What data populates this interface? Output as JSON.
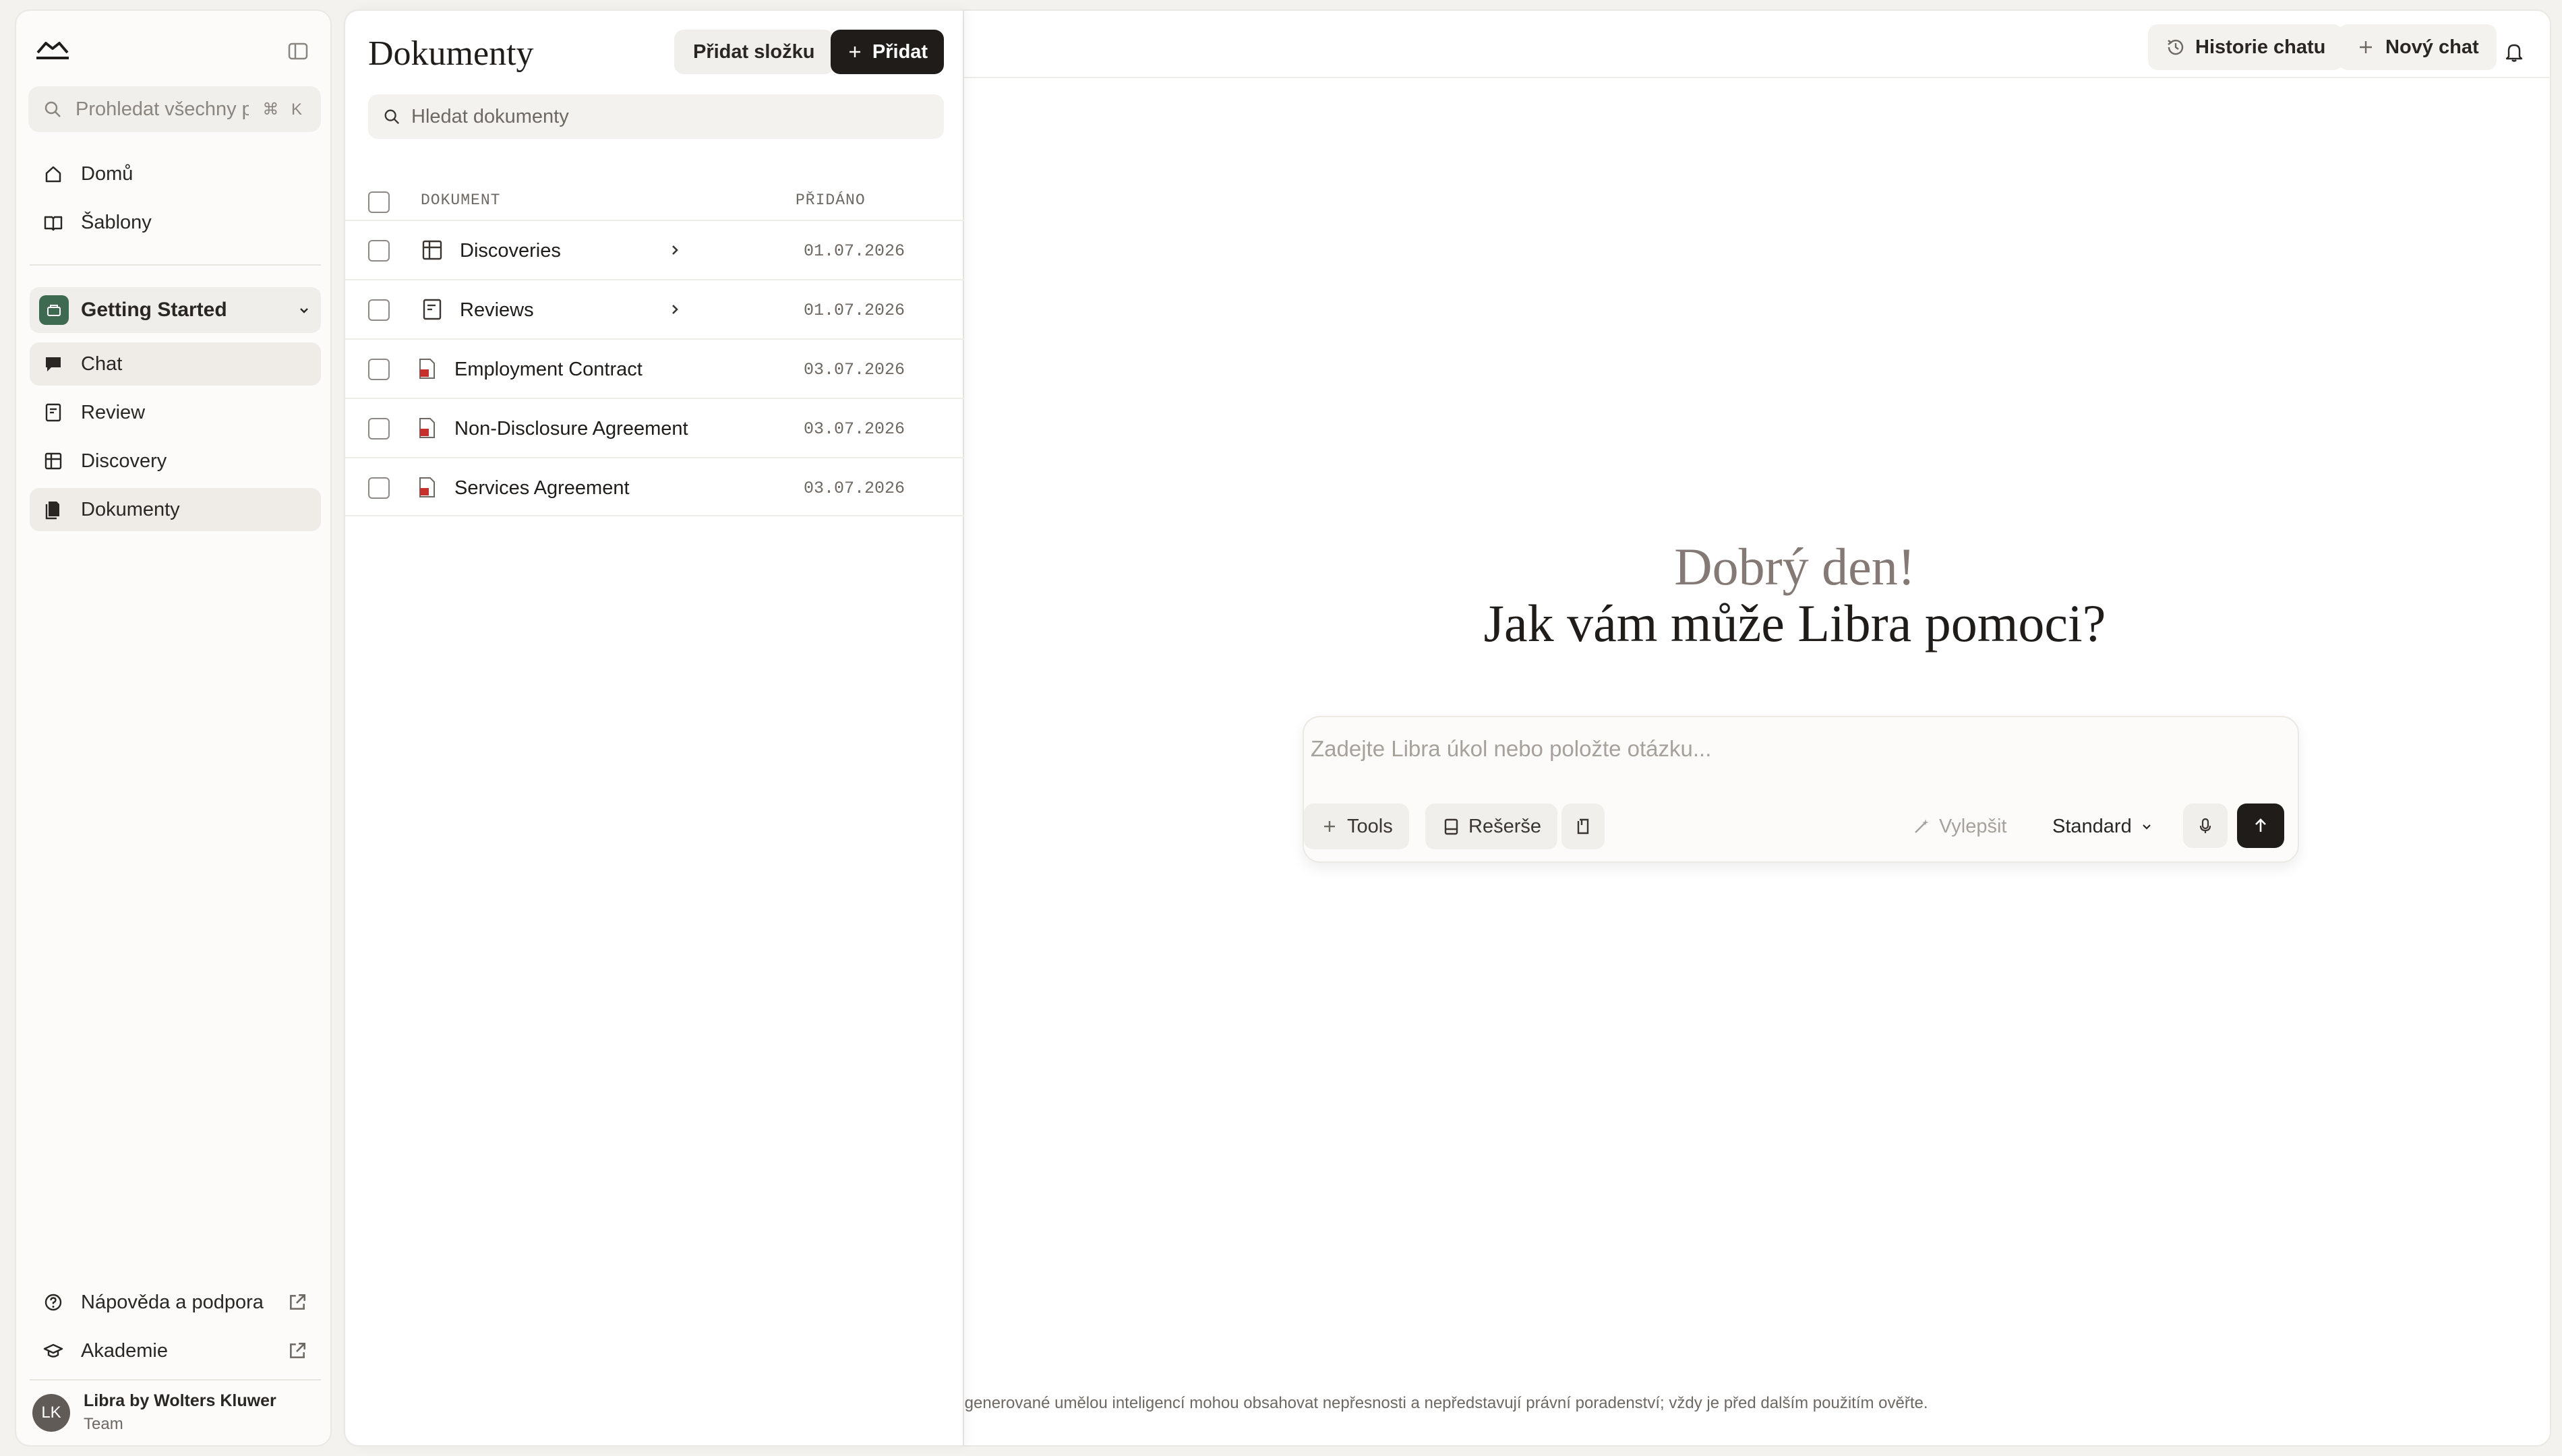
{
  "sidebar": {
    "search_placeholder": "Prohledat všechny p...",
    "search_shortcut": "⌘ K",
    "nav": [
      {
        "label": "Domů",
        "icon": "home-icon"
      },
      {
        "label": "Šablony",
        "icon": "book-icon"
      }
    ],
    "workspace": {
      "label": "Getting Started"
    },
    "workspace_nav": [
      {
        "label": "Chat",
        "icon": "chat-icon"
      },
      {
        "label": "Review",
        "icon": "review-icon"
      },
      {
        "label": "Discovery",
        "icon": "table-icon"
      },
      {
        "label": "Dokumenty",
        "icon": "documents-icon",
        "active": true
      }
    ],
    "bottom_nav": [
      {
        "label": "Nápověda a podpora",
        "icon": "help-icon"
      },
      {
        "label": "Akademie",
        "icon": "graduation-icon"
      }
    ],
    "profile": {
      "initials": "LK",
      "name": "Libra by Wolters Kluwer",
      "role": "Team"
    }
  },
  "topbar": {
    "history_label": "Historie chatu",
    "new_chat_label": "Nový chat"
  },
  "chat": {
    "greeting": "Dobrý den!",
    "subtitle": "Jak vám může Libra pomoci?",
    "input_placeholder": "Zadejte Libra úkol nebo položte otázku...",
    "tools_label": "Tools",
    "research_label": "Rešerše",
    "improve_label": "Vylepšit",
    "mode_label": "Standard",
    "disclaimer": "y generované umělou inteligencí mohou obsahovat nepřesnosti a nepředstavují právní poradenství; vždy je před dalším použitím ověřte."
  },
  "documents": {
    "title": "Dokumenty",
    "add_folder_label": "Přidat složku",
    "add_label": "Přidat",
    "search_placeholder": "Hledat dokumenty",
    "columns": {
      "document": "DOKUMENT",
      "added": "PŘIDÁNO"
    },
    "rows": [
      {
        "name": "Discoveries",
        "date": "01.07.2026",
        "type": "discovery-folder"
      },
      {
        "name": "Reviews",
        "date": "01.07.2026",
        "type": "review-folder"
      },
      {
        "name": "Employment Contract",
        "date": "03.07.2026",
        "type": "pdf"
      },
      {
        "name": "Non-Disclosure Agreement",
        "date": "03.07.2026",
        "type": "pdf"
      },
      {
        "name": "Services Agreement",
        "date": "03.07.2026",
        "type": "pdf"
      }
    ]
  },
  "colors": {
    "accent_dark": "#1f1c1a",
    "workspace_badge": "#3e6a52",
    "pdf_red": "#c8302c"
  }
}
